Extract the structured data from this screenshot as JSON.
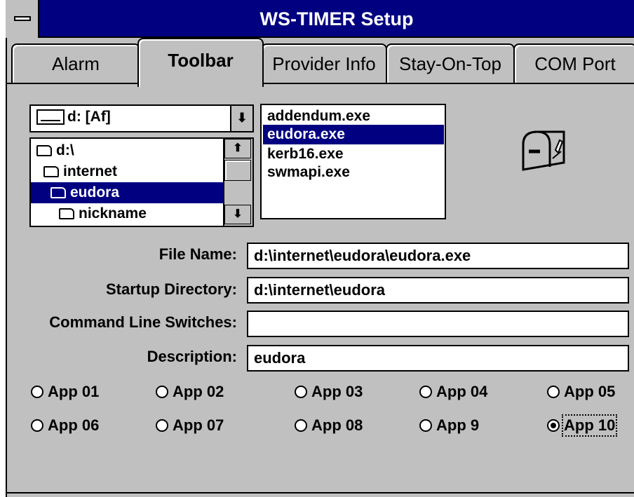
{
  "window": {
    "title": "WS-TIMER Setup"
  },
  "tabs": [
    {
      "label": "Alarm",
      "active": false
    },
    {
      "label": "Toolbar",
      "active": true
    },
    {
      "label": "Provider Info",
      "active": false
    },
    {
      "label": "Stay-On-Top",
      "active": false
    },
    {
      "label": "COM Port",
      "active": false
    }
  ],
  "drive": {
    "value": "d: [Af]",
    "icon": "drive-icon"
  },
  "directories": [
    {
      "label": "d:\\",
      "icon": "open-folder-icon"
    },
    {
      "label": "internet",
      "icon": "open-folder-icon"
    },
    {
      "label": "eudora",
      "icon": "open-folder-icon",
      "selected": true
    },
    {
      "label": "nickname",
      "icon": "folder-icon"
    }
  ],
  "files": [
    {
      "label": "addendum.exe"
    },
    {
      "label": "eudora.exe",
      "selected": true
    },
    {
      "label": "kerb16.exe"
    },
    {
      "label": "swmapi.exe"
    }
  ],
  "app_icon": "mailbox-icon",
  "fields": {
    "file_name": {
      "label": "File Name:",
      "value": "d:\\internet\\eudora\\eudora.exe"
    },
    "startup_dir": {
      "label": "Startup Directory:",
      "value": "d:\\internet\\eudora"
    },
    "switches": {
      "label": "Command Line Switches:",
      "value": ""
    },
    "description": {
      "label": "Description:",
      "value": "eudora"
    }
  },
  "apps": [
    {
      "label": "App 01",
      "checked": false
    },
    {
      "label": "App 02",
      "checked": false
    },
    {
      "label": "App 03",
      "checked": false
    },
    {
      "label": "App 04",
      "checked": false
    },
    {
      "label": "App 05",
      "checked": false
    },
    {
      "label": "App 06",
      "checked": false
    },
    {
      "label": "App 07",
      "checked": false
    },
    {
      "label": "App 08",
      "checked": false
    },
    {
      "label": "App 9",
      "checked": false
    },
    {
      "label": "App 10",
      "checked": true
    }
  ],
  "colors": {
    "title_bar": "#000080",
    "face": "#c0c0c0",
    "selection": "#000080"
  }
}
